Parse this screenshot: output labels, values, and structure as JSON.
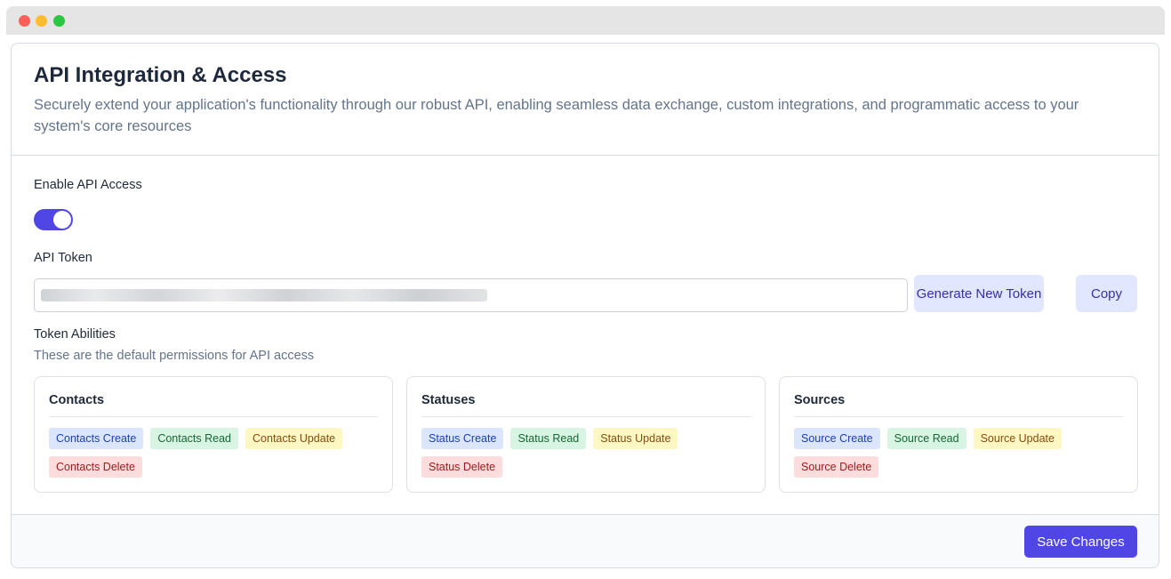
{
  "window": {
    "controls": [
      "close",
      "minimize",
      "maximize"
    ]
  },
  "header": {
    "title": "API Integration & Access",
    "subtitle": "Securely extend your application's functionality through our robust API, enabling seamless data exchange, custom integrations, and programmatic access to your system's core resources"
  },
  "api_access": {
    "label": "Enable API Access",
    "enabled": true,
    "accent_color": "#4f46e5"
  },
  "token": {
    "label": "API Token",
    "value_obscured": true,
    "generate_label": "Generate New Token",
    "copy_label": "Copy"
  },
  "abilities": {
    "label": "Token Abilities",
    "description": "These are the default permissions for API access",
    "groups": [
      {
        "title": "Contacts",
        "badges": [
          "Contacts Create",
          "Contacts Read",
          "Contacts Update",
          "Contacts Delete"
        ]
      },
      {
        "title": "Statuses",
        "badges": [
          "Status Create",
          "Status Read",
          "Status Update",
          "Status Delete"
        ]
      },
      {
        "title": "Sources",
        "badges": [
          "Source Create",
          "Source Read",
          "Source Update",
          "Source Delete"
        ]
      }
    ]
  },
  "footer": {
    "save_label": "Save Changes"
  },
  "colors": {
    "create": "#dbe6fd",
    "read": "#d8f5e3",
    "update": "#fdf7c3",
    "delete": "#fcdcdc",
    "primary": "#4f46e5"
  }
}
